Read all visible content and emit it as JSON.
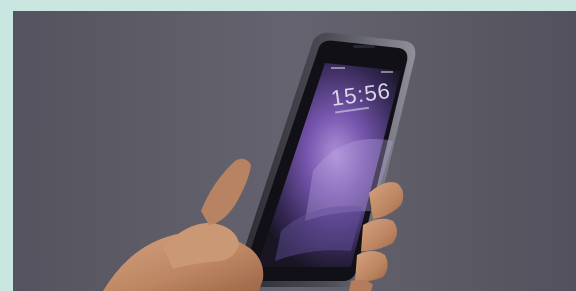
{
  "image": {
    "subject": "smartphone-in-hand",
    "lock_screen_time": "15:56",
    "colors": {
      "border": "#c9e6e1",
      "background": "#5d5c68",
      "phone_frame": "#3a3a42",
      "screen_dark": "#1b1726",
      "screen_glow": "#9a7ad0",
      "skin": "#d9a07a"
    }
  }
}
